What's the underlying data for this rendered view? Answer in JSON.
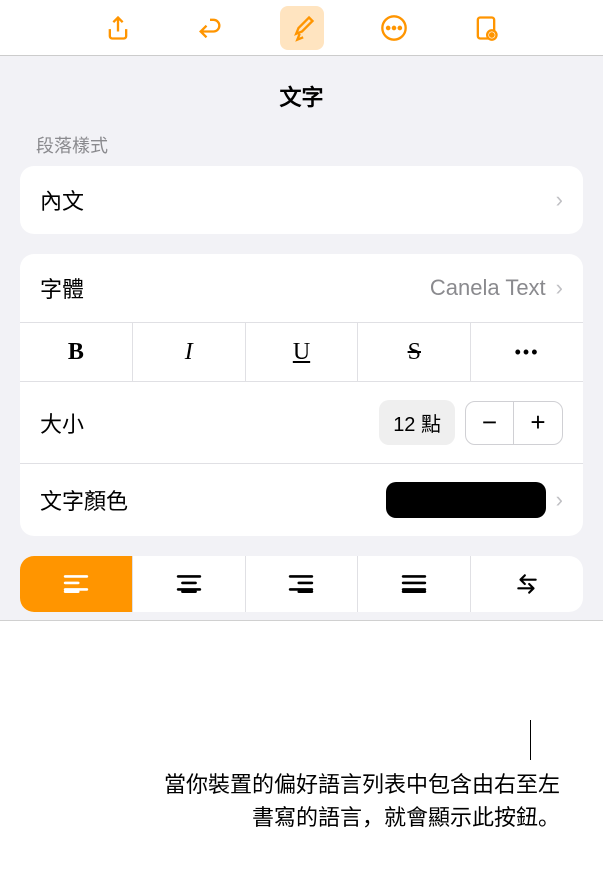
{
  "toolbar": {
    "icons": [
      "share-icon",
      "undo-icon",
      "format-brush-icon",
      "more-icon",
      "document-settings-icon"
    ]
  },
  "panel": {
    "title": "文字",
    "paragraph_style_label": "段落樣式",
    "paragraph_style_value": "內文",
    "font_label": "字體",
    "font_value": "Canela Text",
    "style_buttons": {
      "bold": "B",
      "italic": "I",
      "underline": "U",
      "strike": "S",
      "more": "•••"
    },
    "size_label": "大小",
    "size_value": "12 點",
    "stepper_minus": "−",
    "stepper_plus": "+",
    "color_label": "文字顏色"
  },
  "callout": "當你裝置的偏好語言列表中包含由右至左書寫的語言，就會顯示此按鈕。"
}
